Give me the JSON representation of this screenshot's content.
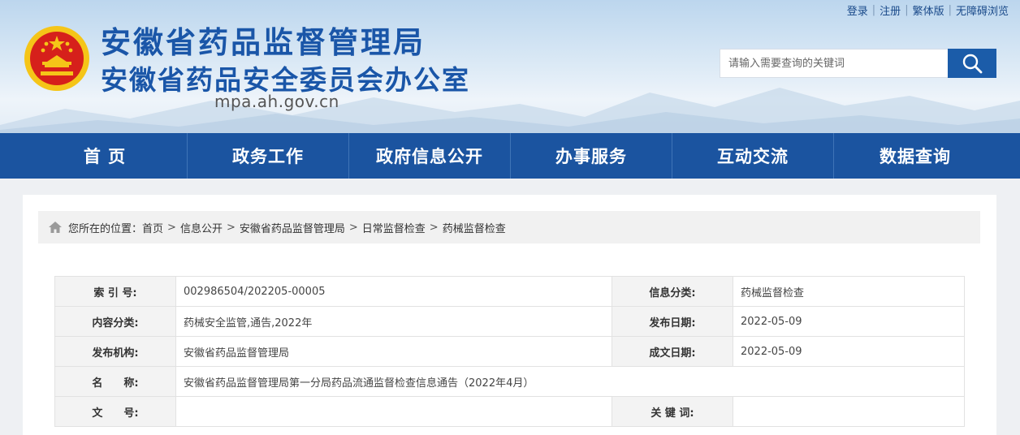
{
  "top_links": [
    "登录",
    "注册",
    "繁体版",
    "无障碍浏览"
  ],
  "site": {
    "title_line1": "安徽省药品监督管理局",
    "title_line2": "安徽省药品安全委员会办公室",
    "domain": "mpa.ah.gov.cn"
  },
  "search": {
    "placeholder": "请输入需要查询的关键词",
    "icon": "search-icon"
  },
  "nav": [
    "首 页",
    "政务工作",
    "政府信息公开",
    "办事服务",
    "互动交流",
    "数据查询"
  ],
  "breadcrumb": {
    "prefix": "您所在的位置：",
    "items": [
      "首页",
      "信息公开",
      "安徽省药品监督管理局",
      "日常监督检查",
      "药械监督检查"
    ],
    "separator": ">",
    "icon": "home-icon"
  },
  "info_table": {
    "index_label": "索 引 号:",
    "index_value": "002986504/202205-00005",
    "category_label": "信息分类:",
    "category_value": "药械监督检查",
    "content_label": "内容分类:",
    "content_value": "药械安全监管,通告,2022年",
    "publish_date_label": "发布日期:",
    "publish_date_value": "2022-05-09",
    "publisher_label": "发布机构:",
    "publisher_value": "安徽省药品监督管理局",
    "created_date_label": "成文日期:",
    "created_date_value": "2022-05-09",
    "name_label": "名　　称:",
    "name_value": "安徽省药品监督管理局第一分局药品流通监督检查信息通告（2022年4月）",
    "doc_no_label": "文　　号:",
    "doc_no_value": "",
    "keywords_label": "关 键 词:",
    "keywords_value": ""
  },
  "colors": {
    "brand_blue": "#1b54a0",
    "title_blue": "#1a56a8",
    "emblem_red": "#d6201b",
    "emblem_gold": "#f5c518"
  }
}
